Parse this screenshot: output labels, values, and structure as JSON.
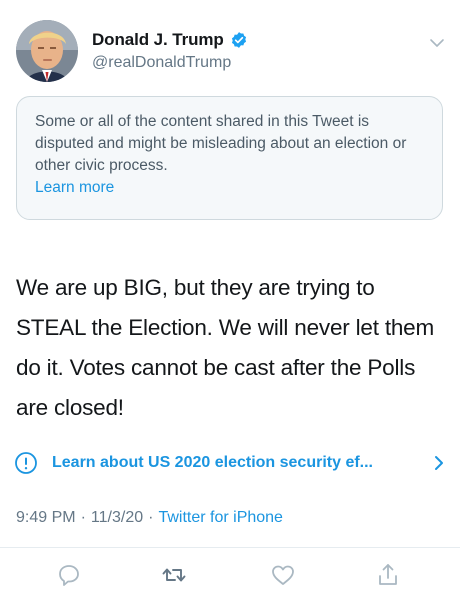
{
  "author": {
    "name": "Donald J. Trump",
    "handle": "@realDonaldTrump",
    "verified": true,
    "avatar_icon": "profile-photo"
  },
  "notice": {
    "text": "Some or all of the content shared in this Tweet is disputed and might be misleading about an election or other civic process.",
    "link_label": "Learn more"
  },
  "tweet": {
    "text": "We are up BIG, but they are trying to STEAL the Election. We will never let them do it. Votes cannot be cast after the Polls are closed!"
  },
  "election_banner": {
    "icon": "info-circle-icon",
    "label": "Learn about US 2020 election security ef..."
  },
  "meta": {
    "time": "9:49 PM",
    "date": "11/3/20",
    "separator": "·",
    "source": "Twitter for iPhone"
  },
  "actions": [
    "reply-icon",
    "retweet-icon",
    "like-icon",
    "share-icon"
  ],
  "colors": {
    "link": "#1b95e0",
    "secondary_text": "#657786",
    "notice_bg": "#f5f8fa",
    "notice_border": "#cfd9de",
    "verified": "#1da1f2",
    "icon_gray": "#aab8c2"
  }
}
